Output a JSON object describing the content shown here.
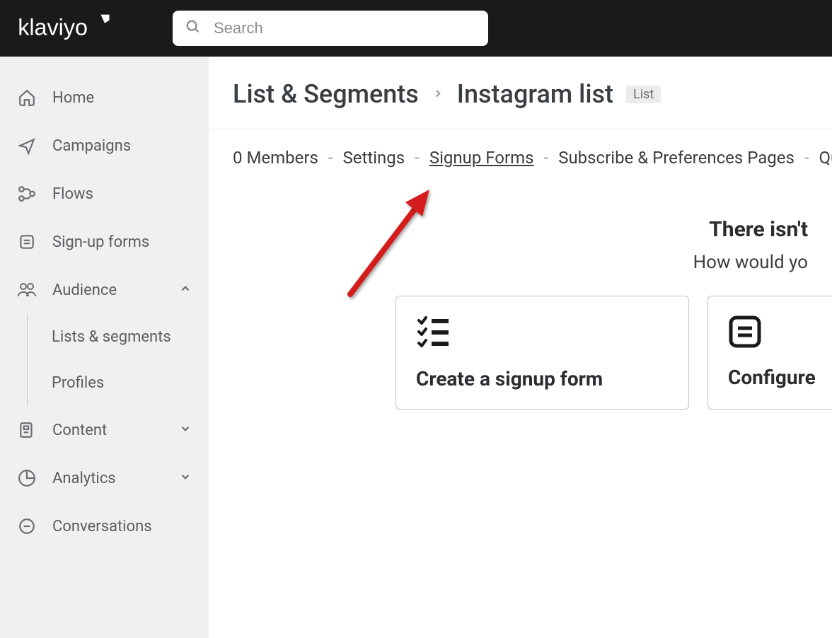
{
  "brand": "klaviyo",
  "search": {
    "placeholder": "Search"
  },
  "sidebar": {
    "items": [
      {
        "label": "Home"
      },
      {
        "label": "Campaigns"
      },
      {
        "label": "Flows"
      },
      {
        "label": "Sign-up forms"
      },
      {
        "label": "Audience"
      },
      {
        "label": "Content"
      },
      {
        "label": "Analytics"
      },
      {
        "label": "Conversations"
      }
    ],
    "audience_sub": [
      {
        "label": "Lists & segments"
      },
      {
        "label": "Profiles"
      }
    ]
  },
  "breadcrumb": {
    "root": "List & Segments",
    "current": "Instagram list",
    "badge": "List"
  },
  "tabs": {
    "members": "0 Members",
    "settings": "Settings",
    "signup_forms": "Signup Forms",
    "subscribe": "Subscribe & Preferences Pages",
    "quick_add": "Quick Add"
  },
  "content": {
    "headline": "There isn't",
    "subline": "How would yo",
    "card1_title": "Create a signup form",
    "card2_title": "Configure"
  }
}
